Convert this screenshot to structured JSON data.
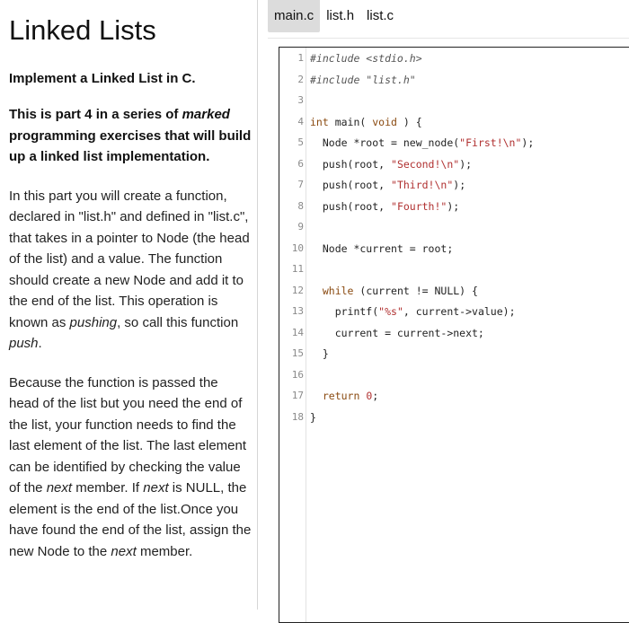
{
  "left": {
    "title": "Linked Lists",
    "subtitle": "Implement a Linked List in C.",
    "intro": {
      "a": "This is part 4 in a series of ",
      "b": "marked",
      "c": " programming exercises that will build up a linked list implementation."
    },
    "p1": {
      "a": "In this part you will create a function, declared in \"list.h\" and defined in \"list.c\", that takes in a pointer to Node (the head of the list) and a value. The function should create a new Node and add it to the end of the list. This operation is known as ",
      "b": "pushing",
      "c": ", so call this function ",
      "d": "push",
      "e": "."
    },
    "p2": {
      "a": "Because the function is passed the head of the list but you need the end of the list, your function needs to find the last element of the list. The last element can be identified by checking the value of the ",
      "b": "next",
      "c": " member. If ",
      "d": "next",
      "e": " is NULL, the element is the end of the list.Once you have found the end of the list, assign the new Node to the ",
      "f": "next",
      "g": " member."
    }
  },
  "tabs": [
    "main.c",
    "list.h",
    "list.c"
  ],
  "active_tab": "main.c",
  "code": {
    "line_numbers": [
      "1",
      "2",
      "3",
      "4",
      "5",
      "6",
      "7",
      "8",
      "9",
      "10",
      "11",
      "12",
      "13",
      "14",
      "15",
      "16",
      "17",
      "18"
    ],
    "lines": [
      [
        [
          "cm",
          "#include <stdio.h>"
        ]
      ],
      [
        [
          "cm",
          "#include \"list.h\""
        ]
      ],
      [],
      [
        [
          "kw",
          "int"
        ],
        [
          "p",
          " main( "
        ],
        [
          "kw",
          "void"
        ],
        [
          "p",
          " ) {"
        ]
      ],
      [
        [
          "p",
          "  Node *root = new_node("
        ],
        [
          "str",
          "\"First!\\n\""
        ],
        [
          "p",
          ");"
        ]
      ],
      [
        [
          "p",
          "  push(root, "
        ],
        [
          "str",
          "\"Second!\\n\""
        ],
        [
          "p",
          ");"
        ]
      ],
      [
        [
          "p",
          "  push(root, "
        ],
        [
          "str",
          "\"Third!\\n\""
        ],
        [
          "p",
          ");"
        ]
      ],
      [
        [
          "p",
          "  push(root, "
        ],
        [
          "str",
          "\"Fourth!\""
        ],
        [
          "p",
          ");"
        ]
      ],
      [],
      [
        [
          "p",
          "  Node *current = root;"
        ]
      ],
      [],
      [
        [
          "p",
          "  "
        ],
        [
          "kw",
          "while"
        ],
        [
          "p",
          " (current != NULL) {"
        ]
      ],
      [
        [
          "p",
          "    printf("
        ],
        [
          "str",
          "\"%s\""
        ],
        [
          "p",
          ", current->value);"
        ]
      ],
      [
        [
          "p",
          "    current = current->next;"
        ]
      ],
      [
        [
          "p",
          "  }"
        ]
      ],
      [],
      [
        [
          "p",
          "  "
        ],
        [
          "kw",
          "return"
        ],
        [
          "p",
          " "
        ],
        [
          "str",
          "0"
        ],
        [
          "p",
          ";"
        ]
      ],
      [
        [
          "p",
          "}"
        ]
      ]
    ]
  },
  "colors": {
    "active_tab_bg": "#dcdcdc",
    "keyword": "#8a4a10",
    "string": "#b03030",
    "comment": "#555555",
    "line_number": "#8a8a8a"
  }
}
